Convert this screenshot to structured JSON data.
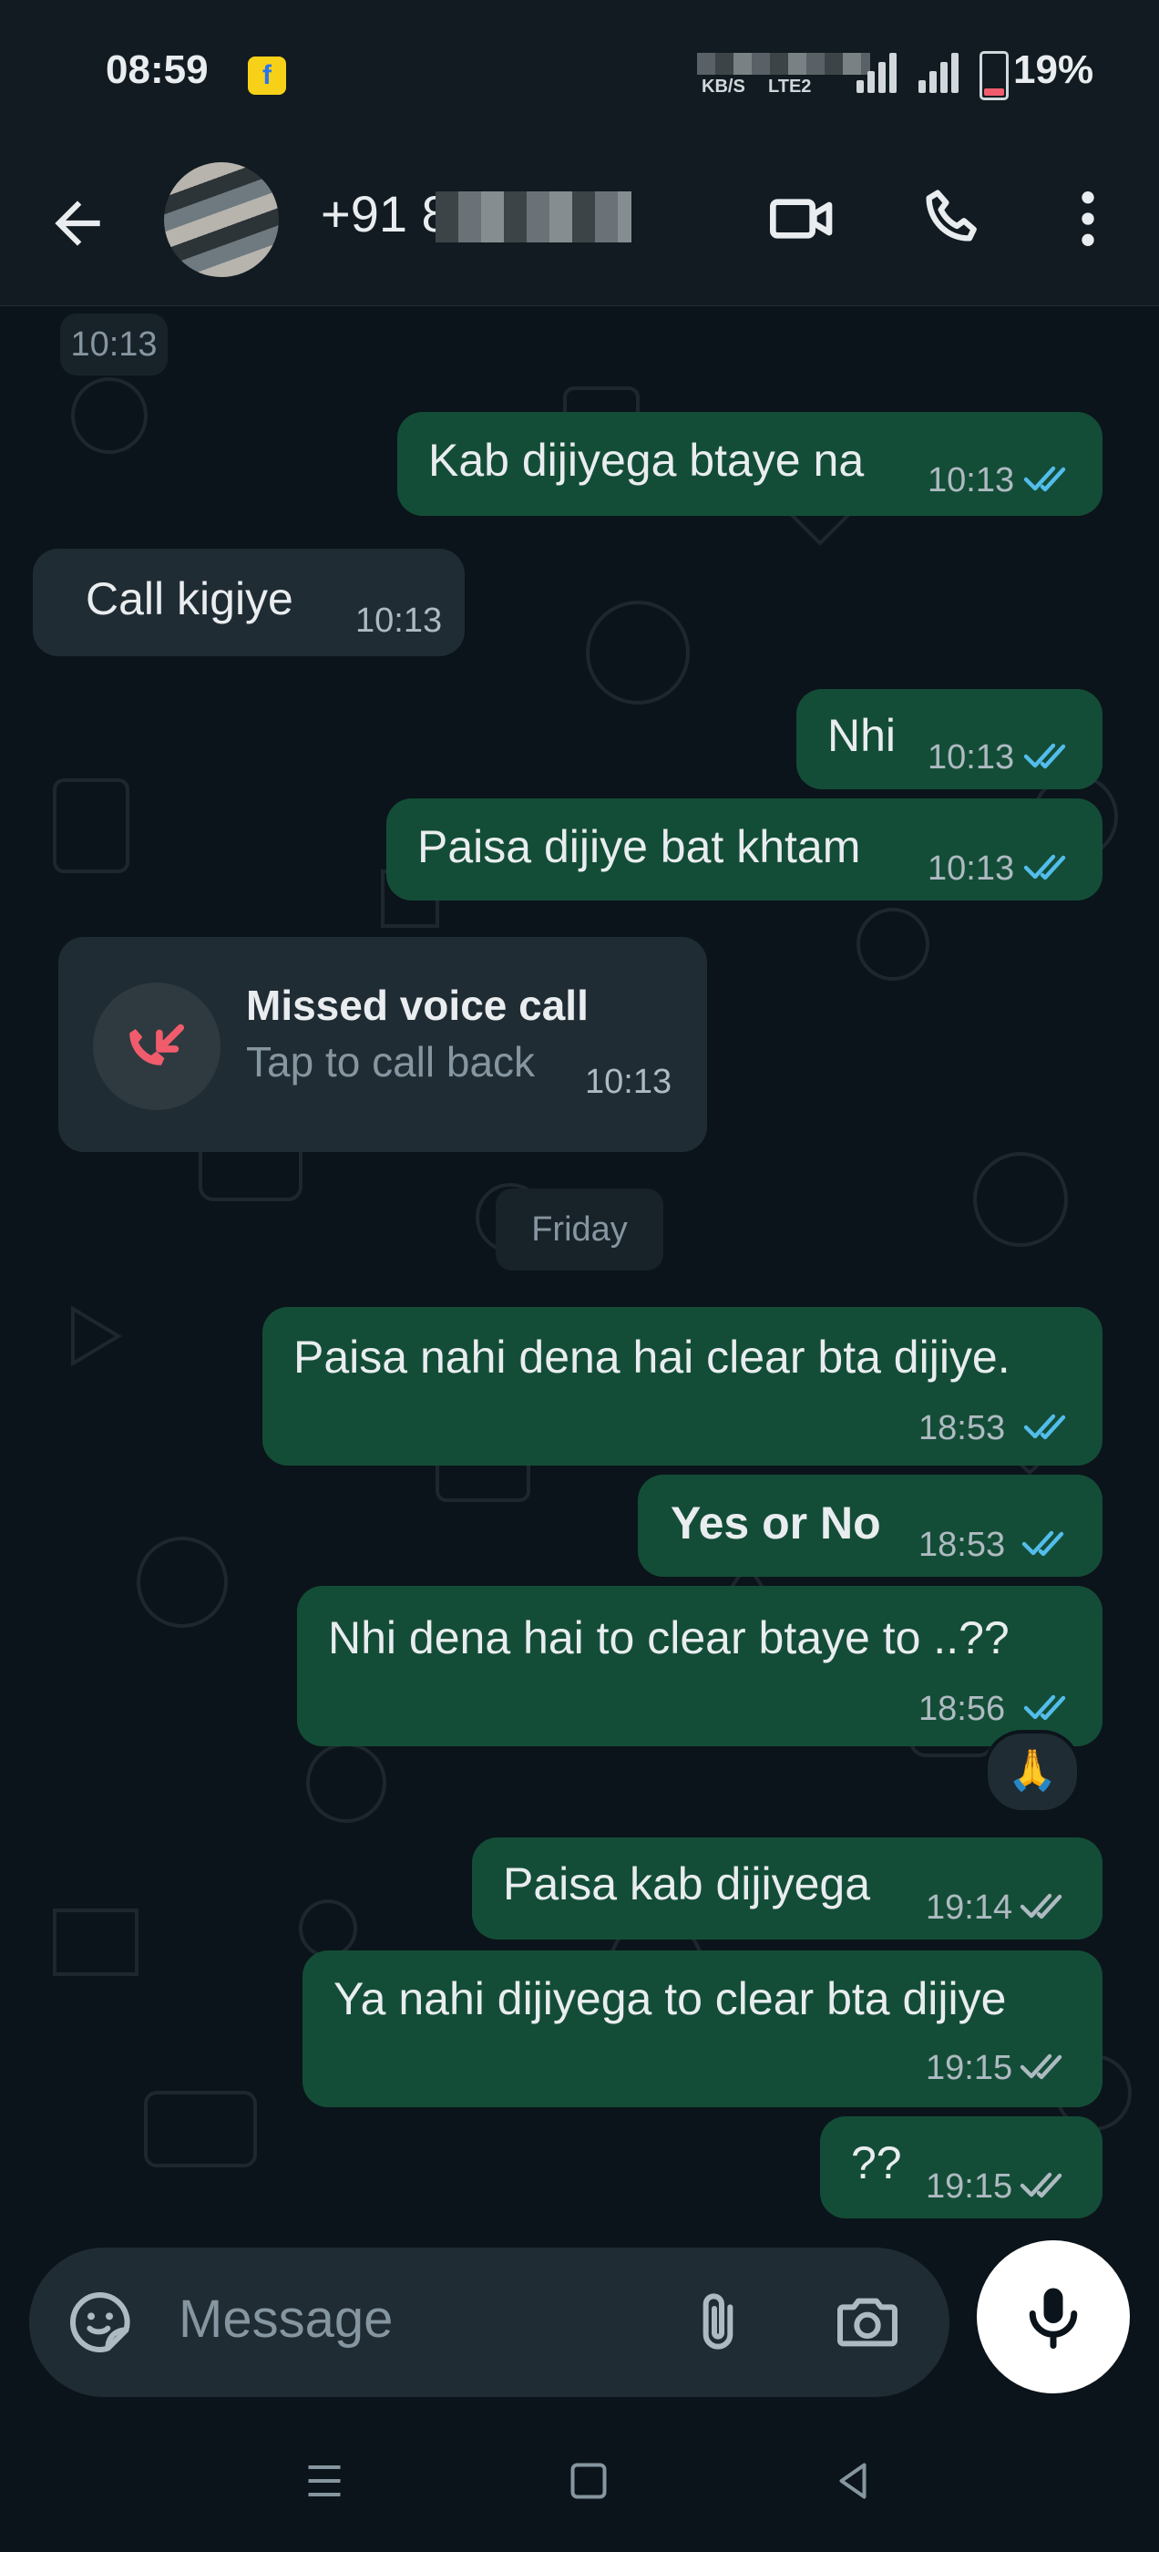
{
  "status_bar": {
    "time": "08:59",
    "net_speed_unit": "KB/S",
    "network_type": "LTE2",
    "battery": "19%",
    "battery_level": 0.19
  },
  "header": {
    "contact_name": "+91 8      27...",
    "icons": [
      "back-arrow-icon",
      "avatar",
      "video-call-icon",
      "voice-call-icon",
      "more-options-icon"
    ]
  },
  "messages": [
    {
      "type": "timestamp-chip",
      "time": "10:13"
    },
    {
      "dir": "out",
      "text": "Kab dijiyega btaye na",
      "time": "10:13",
      "status": "read"
    },
    {
      "dir": "in",
      "text": "Call kigiye",
      "time": "10:13"
    },
    {
      "dir": "out",
      "text": "Nhi",
      "time": "10:13",
      "status": "read"
    },
    {
      "dir": "out",
      "text": "Paisa dijiye bat khtam",
      "time": "10:13",
      "status": "read"
    },
    {
      "dir": "in",
      "type": "missed-call",
      "title": "Missed voice call",
      "subtitle": "Tap to call back",
      "time": "10:13"
    },
    {
      "type": "date-chip",
      "text": "Friday"
    },
    {
      "dir": "out",
      "text": "Paisa nahi dena hai clear bta dijiye.",
      "time": "18:53",
      "status": "read"
    },
    {
      "dir": "out",
      "text": "Yes or No",
      "time": "18:53",
      "status": "read",
      "bold": true
    },
    {
      "dir": "out",
      "text": "Nhi dena hai to clear btaye to ..??",
      "time": "18:56",
      "status": "read",
      "reaction": "🙏"
    },
    {
      "dir": "out",
      "text": "Paisa kab dijiyega",
      "time": "19:14",
      "status": "delivered"
    },
    {
      "dir": "out",
      "text": "Ya nahi dijiyega to clear bta dijiye",
      "time": "19:15",
      "status": "delivered"
    },
    {
      "dir": "out",
      "text": "??",
      "time": "19:15",
      "status": "delivered"
    }
  ],
  "composer": {
    "placeholder": "Message",
    "icons": [
      "sticker-icon",
      "attach-icon",
      "camera-icon",
      "mic-icon"
    ]
  },
  "nav_bar": {
    "icons": [
      "recents-icon",
      "home-icon",
      "back-icon"
    ]
  },
  "colors": {
    "background": "#0b141a",
    "outgoing_bubble": "#144d37",
    "incoming_bubble": "#202c33",
    "read_ticks": "#53bdeb",
    "delivered_ticks": "#aebac1",
    "missed_call_red": "#f15c6d"
  }
}
